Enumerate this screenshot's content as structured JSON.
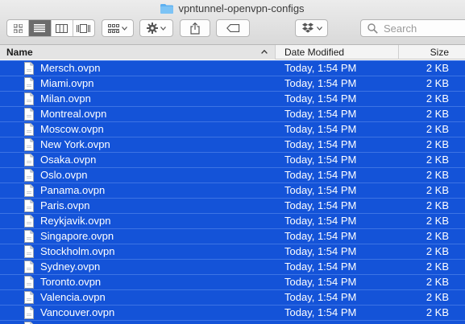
{
  "window": {
    "title": "vpntunnel-openvpn-configs"
  },
  "toolbar": {
    "view_icons": [
      "icon-view-icon",
      "list-view-icon",
      "column-view-icon",
      "cover-flow-icon"
    ],
    "search_placeholder": "Search"
  },
  "columns": {
    "name": "Name",
    "date": "Date Modified",
    "size": "Size"
  },
  "files": [
    {
      "name": "Mersch.ovpn",
      "date": "Today, 1:54 PM",
      "size": "2 KB"
    },
    {
      "name": "Miami.ovpn",
      "date": "Today, 1:54 PM",
      "size": "2 KB"
    },
    {
      "name": "Milan.ovpn",
      "date": "Today, 1:54 PM",
      "size": "2 KB"
    },
    {
      "name": "Montreal.ovpn",
      "date": "Today, 1:54 PM",
      "size": "2 KB"
    },
    {
      "name": "Moscow.ovpn",
      "date": "Today, 1:54 PM",
      "size": "2 KB"
    },
    {
      "name": "New York.ovpn",
      "date": "Today, 1:54 PM",
      "size": "2 KB"
    },
    {
      "name": "Osaka.ovpn",
      "date": "Today, 1:54 PM",
      "size": "2 KB"
    },
    {
      "name": "Oslo.ovpn",
      "date": "Today, 1:54 PM",
      "size": "2 KB"
    },
    {
      "name": "Panama.ovpn",
      "date": "Today, 1:54 PM",
      "size": "2 KB"
    },
    {
      "name": "Paris.ovpn",
      "date": "Today, 1:54 PM",
      "size": "2 KB"
    },
    {
      "name": "Reykjavik.ovpn",
      "date": "Today, 1:54 PM",
      "size": "2 KB"
    },
    {
      "name": "Singapore.ovpn",
      "date": "Today, 1:54 PM",
      "size": "2 KB"
    },
    {
      "name": "Stockholm.ovpn",
      "date": "Today, 1:54 PM",
      "size": "2 KB"
    },
    {
      "name": "Sydney.ovpn",
      "date": "Today, 1:54 PM",
      "size": "2 KB"
    },
    {
      "name": "Toronto.ovpn",
      "date": "Today, 1:54 PM",
      "size": "2 KB"
    },
    {
      "name": "Valencia.ovpn",
      "date": "Today, 1:54 PM",
      "size": "2 KB"
    },
    {
      "name": "Vancouver.ovpn",
      "date": "Today, 1:54 PM",
      "size": "2 KB"
    },
    {
      "name": "",
      "date": "",
      "size": ""
    }
  ],
  "colors": {
    "selection": "#1453d8",
    "folder": "#5db0f0"
  }
}
